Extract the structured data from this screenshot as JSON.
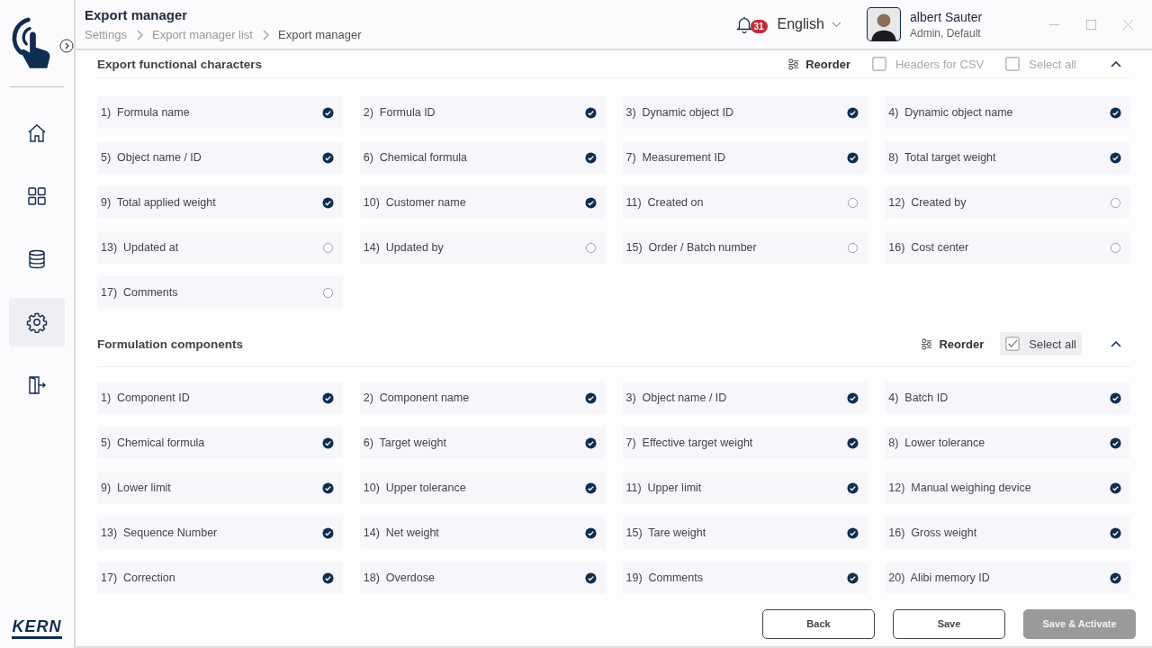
{
  "header": {
    "title": "Export manager",
    "breadcrumbs": [
      {
        "label": "Settings",
        "current": false
      },
      {
        "label": "Export manager list",
        "current": false
      },
      {
        "label": "Export manager",
        "current": true
      }
    ],
    "notifications": "31",
    "language": "English",
    "user": {
      "name": "albert Sauter",
      "role": "Admin, Default"
    }
  },
  "sidebar": {
    "items": [
      {
        "kind": "home",
        "selected": false
      },
      {
        "kind": "grid",
        "selected": false
      },
      {
        "kind": "database",
        "selected": false
      },
      {
        "kind": "settings",
        "selected": true
      },
      {
        "kind": "exit",
        "selected": false
      }
    ],
    "brand": "KERN"
  },
  "sections": [
    {
      "title": "Export functional characters",
      "reorder": "Reorder",
      "options": [
        {
          "label": "Headers for CSV",
          "checked": false
        },
        {
          "label": "Select all",
          "checked": false
        }
      ],
      "expanded": true,
      "items": [
        {
          "number": "1)",
          "label": "Formula name",
          "checked": true
        },
        {
          "number": "2)",
          "label": "Formula ID",
          "checked": true
        },
        {
          "number": "3)",
          "label": "Dynamic object ID",
          "checked": true
        },
        {
          "number": "4)",
          "label": "Dynamic object name",
          "checked": true
        },
        {
          "number": "5)",
          "label": "Object name / ID",
          "checked": true
        },
        {
          "number": "6)",
          "label": "Chemical formula",
          "checked": true
        },
        {
          "number": "7)",
          "label": "Measurement ID",
          "checked": true
        },
        {
          "number": "8)",
          "label": "Total target weight",
          "checked": true
        },
        {
          "number": "9)",
          "label": "Total applied weight",
          "checked": true
        },
        {
          "number": "10)",
          "label": "Customer name",
          "checked": true
        },
        {
          "number": "11)",
          "label": "Created on",
          "checked": false
        },
        {
          "number": "12)",
          "label": "Created by",
          "checked": false
        },
        {
          "number": "13)",
          "label": "Updated at",
          "checked": false
        },
        {
          "number": "14)",
          "label": "Updated by",
          "checked": false
        },
        {
          "number": "15)",
          "label": "Order / Batch number",
          "checked": false
        },
        {
          "number": "16)",
          "label": "Cost center",
          "checked": false
        },
        {
          "number": "17)",
          "label": "Comments",
          "checked": false
        }
      ]
    },
    {
      "title": "Formulation components",
      "reorder": "Reorder",
      "options": [
        {
          "label": "Select all",
          "checked": true
        }
      ],
      "expanded": true,
      "items": [
        {
          "number": "1)",
          "label": "Component ID",
          "checked": true
        },
        {
          "number": "2)",
          "label": "Component name",
          "checked": true
        },
        {
          "number": "3)",
          "label": "Object name / ID",
          "checked": true
        },
        {
          "number": "4)",
          "label": "Batch ID",
          "checked": true
        },
        {
          "number": "5)",
          "label": "Chemical formula",
          "checked": true
        },
        {
          "number": "6)",
          "label": "Target weight",
          "checked": true
        },
        {
          "number": "7)",
          "label": "Effective target weight",
          "checked": true
        },
        {
          "number": "8)",
          "label": "Lower tolerance",
          "checked": true
        },
        {
          "number": "9)",
          "label": "Lower limit",
          "checked": true
        },
        {
          "number": "10)",
          "label": "Upper tolerance",
          "checked": true
        },
        {
          "number": "11)",
          "label": "Upper limit",
          "checked": true
        },
        {
          "number": "12)",
          "label": "Manual weighing device",
          "checked": true
        },
        {
          "number": "13)",
          "label": "Sequence Number",
          "checked": true
        },
        {
          "number": "14)",
          "label": "Net weight",
          "checked": true
        },
        {
          "number": "15)",
          "label": "Tare weight",
          "checked": true
        },
        {
          "number": "16)",
          "label": "Gross weight",
          "checked": true
        },
        {
          "number": "17)",
          "label": "Correction",
          "checked": true
        },
        {
          "number": "18)",
          "label": "Overdose",
          "checked": true
        },
        {
          "number": "19)",
          "label": "Comments",
          "checked": true
        },
        {
          "number": "20)",
          "label": "Alibi memory ID",
          "checked": true
        }
      ]
    }
  ],
  "footer": {
    "buttons": [
      {
        "label": "Back",
        "disabled": false
      },
      {
        "label": "Save",
        "disabled": false
      },
      {
        "label": "Save & Activate",
        "disabled": true
      }
    ]
  }
}
